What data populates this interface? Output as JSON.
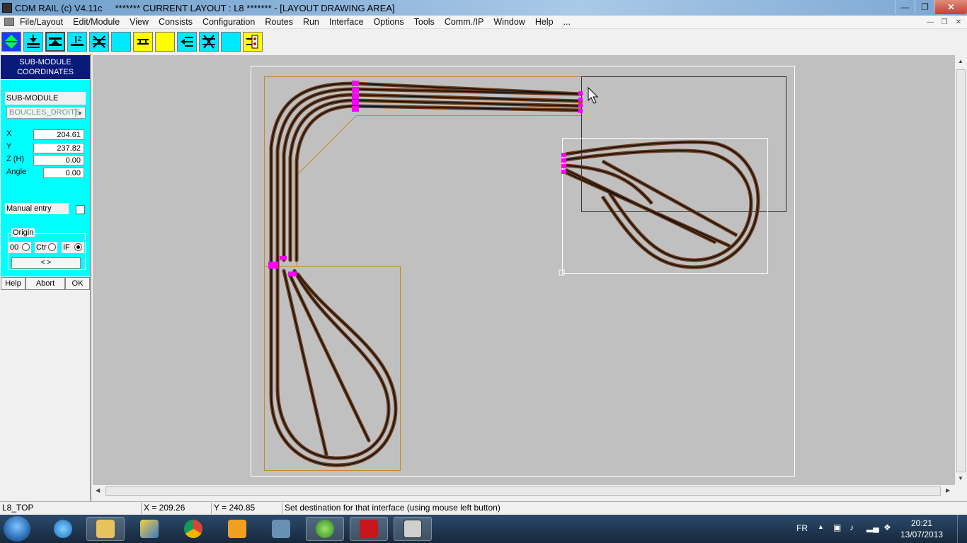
{
  "window": {
    "title": "CDM RAIL (c) V4.11c     ******* CURRENT LAYOUT : L8 ******* - [LAYOUT DRAWING AREA]"
  },
  "menu": {
    "items": [
      "File/Layout",
      "Edit/Module",
      "View",
      "Consists",
      "Configuration",
      "Routes",
      "Run",
      "Interface",
      "Options",
      "Tools",
      "Comm./IP",
      "Window",
      "Help",
      "..."
    ]
  },
  "panel": {
    "header_line1": "SUB-MODULE",
    "header_line2": "COORDINATES",
    "submodule_label": "SUB-MODULE",
    "submodule_value": "BOUCLES_DROITE",
    "x_label": "X",
    "x_value": "204.61",
    "y_label": "Y",
    "y_value": "237.82",
    "z_label": "Z (H)",
    "z_value": "0.00",
    "angle_label": "Angle",
    "angle_value": "0.00",
    "manual_entry_label": "Manual entry",
    "origin_label": "Origin",
    "origin_00": "00",
    "origin_ctr": "Ctr",
    "origin_if": "IF",
    "nav_label": "<  >",
    "help_label": "Help",
    "abort_label": "Abort",
    "ok_label": "OK"
  },
  "status": {
    "layout": "L8_TOP",
    "x_readout": "X =    209.26",
    "y_readout": "Y =    240.85",
    "message": "Set destination for that interface (using mouse left button)"
  },
  "taskbar": {
    "lang": "FR",
    "time": "20:21",
    "date": "13/07/2013"
  },
  "colors": {
    "panel_header": "#0a1a7a",
    "panel_body": "#00ffff",
    "drawing_bg": "#c0c0c0",
    "track_rail": "#7a3a10",
    "connector": "#ff00ff"
  }
}
